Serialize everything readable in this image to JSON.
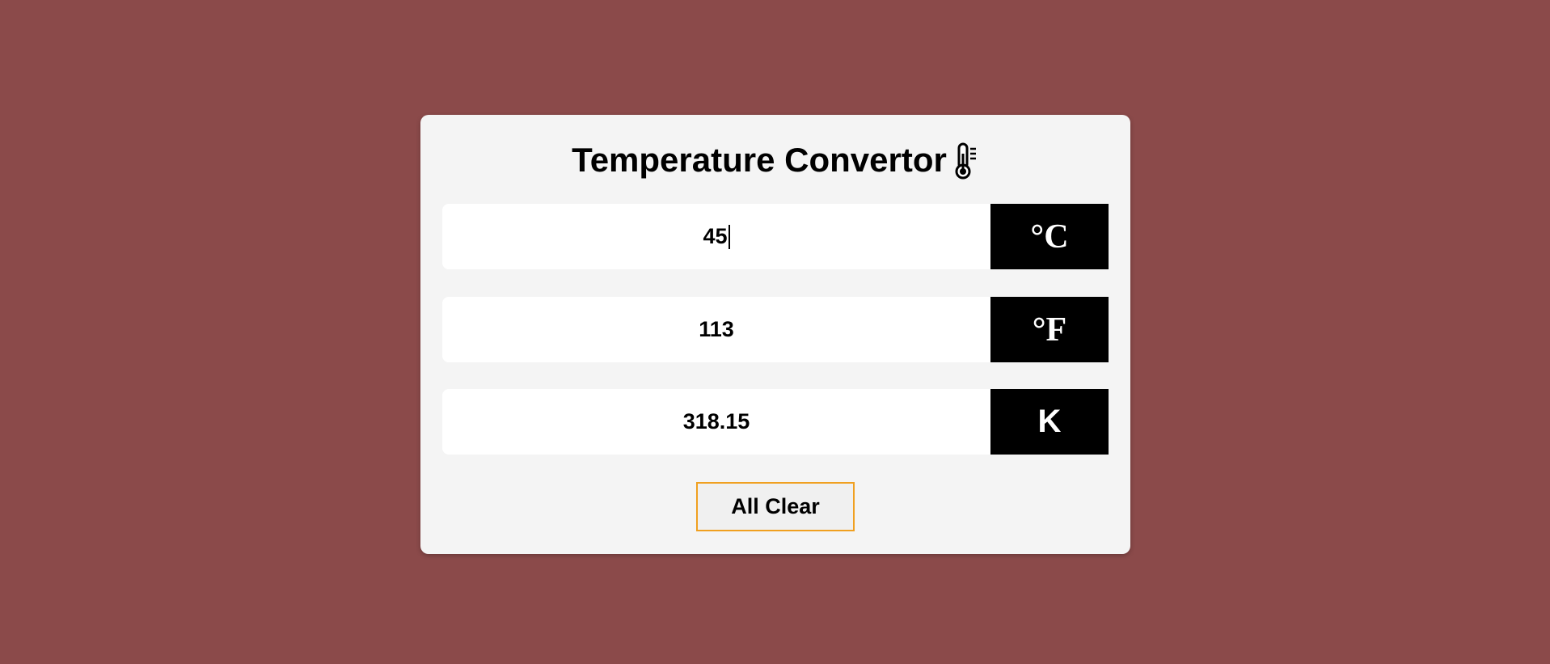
{
  "app": {
    "title": "Temperature Convertor",
    "title_icon": "thermometer-icon"
  },
  "converter": {
    "celsius": {
      "value": "45",
      "unit_label": "°C"
    },
    "fahrenheit": {
      "value": "113",
      "unit_label": "°F"
    },
    "kelvin": {
      "value": "318.15",
      "unit_label": "K"
    }
  },
  "actions": {
    "clear_label": "All Clear"
  },
  "colors": {
    "background": "#8b4a4a",
    "card": "#f4f4f4",
    "unit_bg": "#000000",
    "button_border": "#f0a020"
  }
}
